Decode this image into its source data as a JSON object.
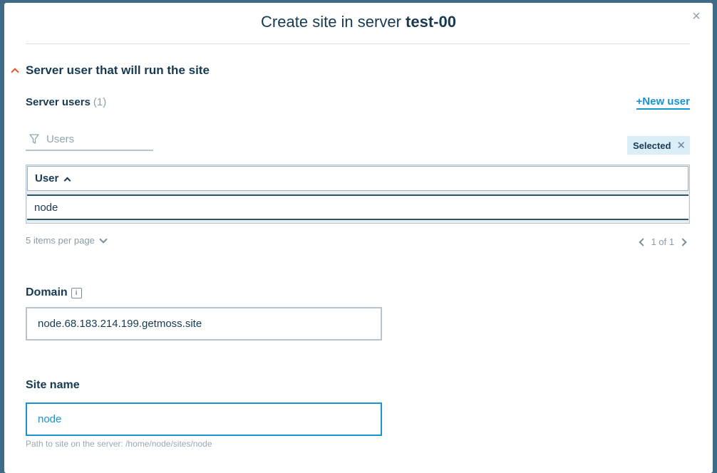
{
  "dialog": {
    "title_prefix": "Create site in server ",
    "title_server": "test-00",
    "close_glyph": "×",
    "close_icon": "close-icon"
  },
  "section": {
    "title": "Server user that will run the site",
    "toggle_icon": "chevron-up-icon",
    "toggle_color": "#e0562b"
  },
  "users": {
    "label": "Server users",
    "count": "(1)",
    "new_user_label": "+New user",
    "filter_placeholder": "Users",
    "filter_icon": "filter-icon",
    "selected_chip": "Selected",
    "chip_remove_glyph": "✕",
    "table": {
      "columns": [
        "User"
      ],
      "sort": "ascending",
      "rows": [
        [
          "node"
        ]
      ]
    },
    "per_page": "5 items per page",
    "pagination": "1 of 1"
  },
  "domain": {
    "label": "Domain",
    "info_glyph": "i",
    "value": "node.68.183.214.199.getmoss.site"
  },
  "site_name": {
    "label": "Site name",
    "value": "node",
    "hint": "Path to site on the server: /home/node/sites/node"
  },
  "colors": {
    "accent": "#1a93d2",
    "text": "#173a52",
    "backdrop": "#3f6b86"
  }
}
